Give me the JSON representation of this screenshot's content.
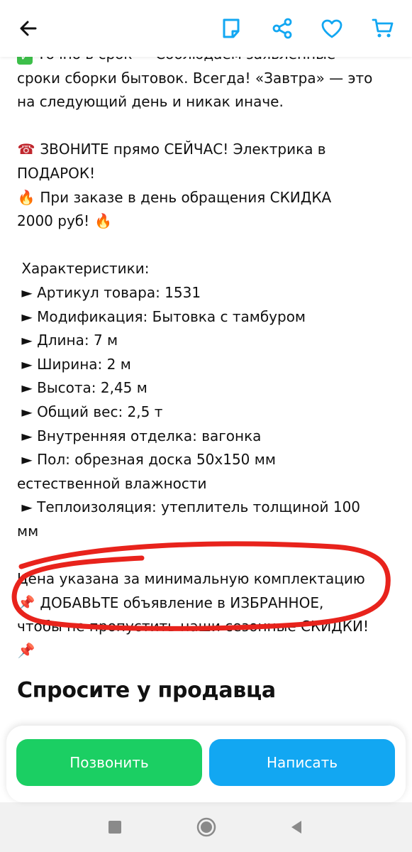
{
  "colors": {
    "accent_blue": "#12a7f2",
    "call_green": "#1bcf63",
    "annotation_red": "#e8231c"
  },
  "header": {
    "icons": [
      "back-arrow-icon",
      "document-icon",
      "share-icon",
      "heart-icon",
      "cart-icon"
    ]
  },
  "description": {
    "line1": "Точно в срок — Соблюдаем заявленные",
    "line2": "сроки сборки бытовок. Всегда! «Завтра» — это",
    "line3": "на следующий день и никак иначе.",
    "call_now_line1": "ЗВОНИТЕ прямо СЕЙЧАС! Электрика в",
    "call_now_line2": "ПОДАРОК!",
    "discount_line1": "При заказе в день обращения СКИДКА",
    "discount_line2": "2000 руб!",
    "specs_title": "Характеристики:",
    "specs": [
      "Артикул товара: 1531",
      "Модификация: Бытовка с тамбуром",
      "Длина: 7 м",
      "Ширина: 2 м",
      "Высота: 2,45 м",
      "Общий вес: 2,5 т",
      "Внутренняя отделка: вагонка",
      "Пол: обрезная доска 50х150 мм",
      "Теплоизоляция: утеплитель толщиной 100"
    ],
    "spec_floor_cont": "естественной влажности",
    "spec_insulation_cont": "мм",
    "price_note": "Цена указана за минимальную комплектацию",
    "favorite_line1": "ДОБАВЬТЕ объявление в ИЗБРАННОЕ,",
    "favorite_line2": "чтобы не пропустить наши сезонные СКИДКИ!"
  },
  "ask_seller": {
    "title": "Спросите у продавца"
  },
  "actions": {
    "call_label": "Позвонить",
    "write_label": "Написать"
  },
  "system_nav": {
    "icons": [
      "recent-apps-icon",
      "home-icon",
      "back-icon"
    ]
  }
}
